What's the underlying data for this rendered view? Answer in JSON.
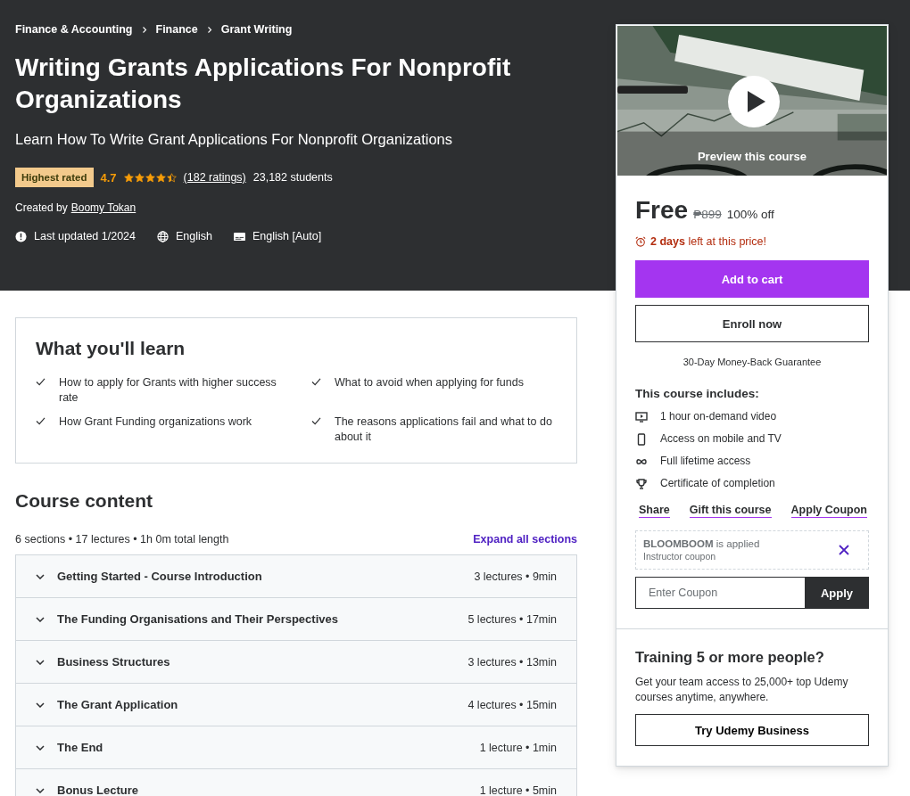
{
  "breadcrumbs": [
    "Finance & Accounting",
    "Finance",
    "Grant Writing"
  ],
  "course": {
    "title": "Writing Grants Applications For Nonprofit Organizations",
    "subtitle": "Learn How To Write Grant Applications For Nonprofit Organizations",
    "badge": "Highest rated",
    "rating": "4.7",
    "stars": 4.5,
    "ratings_count": "(182 ratings)",
    "students": "23,182 students",
    "created_by_label": "Created by",
    "author": "Boomy Tokan",
    "last_updated": "Last updated 1/2024",
    "language": "English",
    "captions": "English [Auto]"
  },
  "learn": {
    "title": "What you'll learn",
    "items": [
      "How to apply for Grants with higher success rate",
      "What to avoid when applying for funds",
      "How Grant Funding organizations work",
      "The reasons applications fail and what to do about it"
    ]
  },
  "content": {
    "title": "Course content",
    "summary": "6 sections • 17 lectures • 1h 0m total length",
    "expand_all": "Expand all sections",
    "sections": [
      {
        "title": "Getting Started - Course Introduction",
        "meta": "3 lectures • 9min"
      },
      {
        "title": "The Funding Organisations and Their Perspectives",
        "meta": "5 lectures • 17min"
      },
      {
        "title": "Business Structures",
        "meta": "3 lectures • 13min"
      },
      {
        "title": "The Grant Application",
        "meta": "4 lectures • 15min"
      },
      {
        "title": "The End",
        "meta": "1 lecture • 1min"
      },
      {
        "title": "Bonus Lecture",
        "meta": "1 lecture • 5min"
      }
    ]
  },
  "sidebar": {
    "preview": {
      "kind": "picture",
      "label": "Preview this course"
    },
    "price": "Free",
    "original_price": "₱899",
    "discount": "100% off",
    "timer_bold": "2 days",
    "timer_rest": "left at this price!",
    "add_to_cart": "Add to cart",
    "enroll": "Enroll now",
    "guarantee": "30-Day Money-Back Guarantee",
    "includes_title": "This course includes:",
    "includes": [
      "1 hour on-demand video",
      "Access on mobile and TV",
      "Full lifetime access",
      "Certificate of completion"
    ],
    "links": [
      "Share",
      "Gift this course",
      "Apply Coupon"
    ],
    "coupon": {
      "code": "BLOOMBOOM",
      "status": "is applied",
      "type": "Instructor coupon"
    },
    "coupon_input": {
      "placeholder": "Enter Coupon"
    },
    "apply": "Apply",
    "business": {
      "title": "Training 5 or more people?",
      "text": "Get your team access to 25,000+ top Udemy courses anytime, anywhere.",
      "button": "Try Udemy Business"
    }
  }
}
